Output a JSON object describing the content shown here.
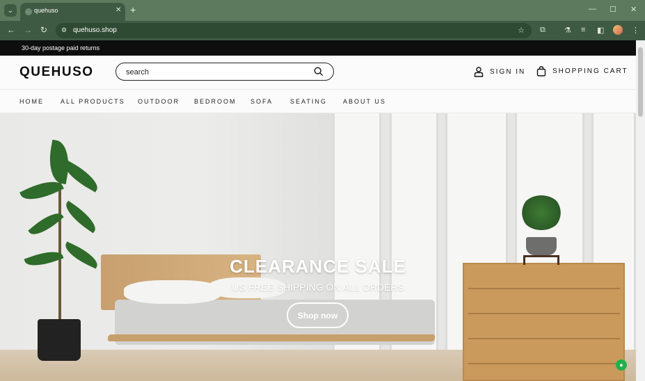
{
  "browser": {
    "tab_title": "quehuso",
    "tab_close": "✕",
    "new_tab": "+",
    "url": "quehuso.shop",
    "window_controls": {
      "minimize": "—",
      "maximize": "☐",
      "close": "✕"
    }
  },
  "announcement": {
    "text": "30-day postage paid returns"
  },
  "header": {
    "logo": "QUEHUSO",
    "search_placeholder": "search",
    "sign_in": "SIGN IN",
    "cart": "SHOPPING CART"
  },
  "nav": {
    "items": [
      "HOME",
      "ALL PRODUCTS",
      "OUTDOOR",
      "BEDROOM",
      "SOFA",
      "SEATING",
      "ABOUT US"
    ]
  },
  "hero": {
    "title": "CLEARANCE SALE",
    "subtitle": "US FREE SHIPPING ON ALL ORDERS",
    "button": "Shop now"
  },
  "icons": {
    "tab_menu": "chevron-down-icon",
    "back": "arrow-left-icon",
    "forward": "arrow-right-icon",
    "reload": "reload-icon",
    "site_info": "site-info-icon",
    "bookmark": "star-icon",
    "extensions": "puzzle-icon",
    "labs": "flask-icon",
    "media": "media-icon",
    "sidepanel": "sidepanel-icon",
    "menu": "kebab-menu-icon",
    "search": "search-icon",
    "user": "user-icon",
    "cart": "shopping-bag-icon",
    "chat": "chat-badge-icon"
  },
  "colors": {
    "chrome": "#3f5a42",
    "chrome_top": "#5d7a5f",
    "announce_bg": "#0e0e0e",
    "chat_badge": "#22b14c"
  }
}
